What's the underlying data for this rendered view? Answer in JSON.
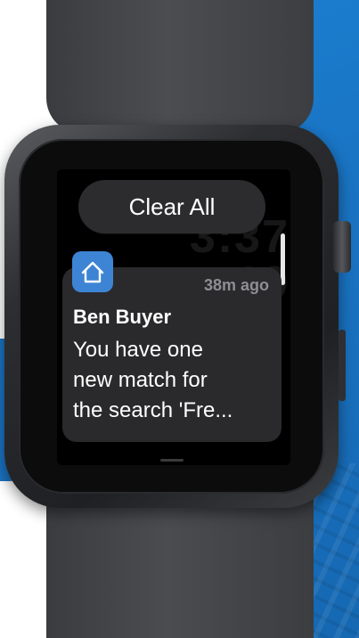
{
  "clear_all_label": "Clear All",
  "clock_digits": "3:37\n19",
  "notification": {
    "time": "38m ago",
    "sender": "Ben Buyer",
    "message_lines": [
      "You have one",
      "new match for",
      "the search 'Fre..."
    ],
    "icon": "house-icon",
    "icon_color": "#3e84d4"
  },
  "colors": {
    "background_blue": "#1a73c2",
    "card_bg": "#2a2a2c",
    "button_bg": "#2c2c2e"
  }
}
